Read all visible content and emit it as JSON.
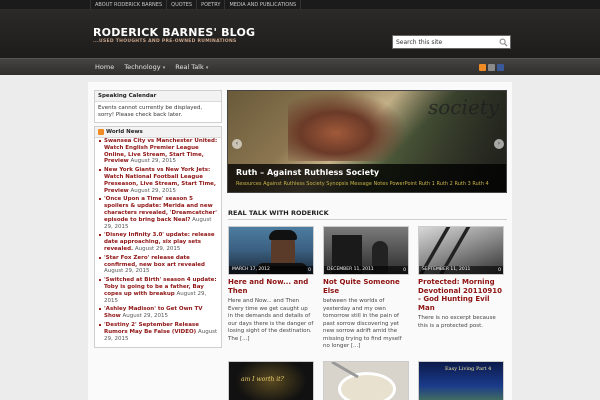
{
  "topnav": {
    "items": [
      "ABOUT RODERICK BARNES",
      "QUOTES",
      "POETRY",
      "MEDIA AND PUBLICATIONS"
    ]
  },
  "header": {
    "title": "RODERICK BARNES' BLOG",
    "tagline": "...USED THOUGHTS AND PRE-OWNED RUMINATIONS",
    "search_placeholder": "Search this site"
  },
  "mainnav": {
    "items": [
      "Home",
      "Technology",
      "Real Talk"
    ],
    "caret": "▾"
  },
  "social": {
    "icons": [
      "rss-icon",
      "email-icon",
      "facebook-icon"
    ],
    "colors": [
      "#f08a24",
      "#8a8a8a",
      "#3b5998"
    ]
  },
  "sidebar": {
    "calendar": {
      "title": "Speaking Calendar",
      "body": "Events cannot currently be displayed, sorry! Please check back later."
    },
    "news": {
      "title": "World News",
      "items": [
        {
          "title": "Swansea City vs Manchester United: Watch English Premier League Online, Live Stream, Start Time, Preview",
          "date": "August 29, 2015"
        },
        {
          "title": "New York Giants vs New York Jets: Watch National Football League Preseason, Live Stream, Start Time, Preview",
          "date": "August 29, 2015"
        },
        {
          "title": "'Once Upon a Time' season 5 spoilers & update: Merida and new characters revealed, 'Dreamcatcher' episode to bring back Neal?",
          "date": "August 29, 2015"
        },
        {
          "title": "'Disney Infinity 3.0' update: release date approaching, six play sets revealed.",
          "date": "August 29, 2015"
        },
        {
          "title": "'Star Fox Zero' release date confirmed, new box art revealed",
          "date": "August 29, 2015"
        },
        {
          "title": "'Switched at Birth' season 4 update: Toby is going to be a father, Bay copes up with breakup",
          "date": "August 29, 2015"
        },
        {
          "title": "'Ashley Madison' to Get Own TV Show",
          "date": "August 29, 2015"
        },
        {
          "title": "'Destiny 2' September Release Rumors May Be False (VIDEO)",
          "date": "August 29, 2015"
        }
      ]
    }
  },
  "slider": {
    "image_word": "society",
    "title": "Ruth – Against Ruthless Society",
    "excerpt": "Resources Against Ruthless Society Synopsis Message Notes PowerPoint Ruth 1 Ruth 2 Ruth 3 Ruth 4",
    "prev": "‹",
    "next": "›"
  },
  "section": {
    "title": "REAL TALK WITH RODERICK"
  },
  "posts": [
    {
      "date": "MARCH 17, 2012",
      "comments": "0",
      "title": "Here and Now... and Then",
      "excerpt": "Here and Now... and Then Every time we get caught up in the demands and details of our days there is the danger of losing sight of the destination. The [...]"
    },
    {
      "date": "DECEMBER 11, 2011",
      "comments": "0",
      "title": "Not Quite Someone Else",
      "excerpt": "between the worlds of yesterday and my own tomorrow still in the pain of past sorrow discovering yet new sorrow adrift amid the missing trying to find myself no longer [...]"
    },
    {
      "date": "SEPTEMBER 11, 2011",
      "comments": "0",
      "title": "Protected: Morning Devotional 20110910 - God Hunting Evil Man",
      "excerpt": "There is no excerpt because this is a protected post."
    }
  ],
  "thumbs_row2": {
    "thumb4_text": "am I worth it?",
    "thumb6_text": "Easy Living Part 4"
  }
}
